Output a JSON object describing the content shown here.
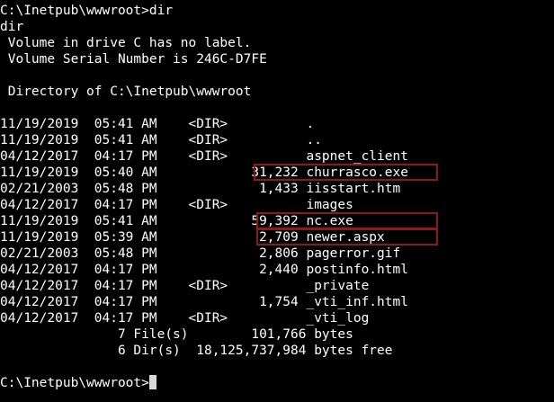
{
  "terminal": {
    "lines": [
      "C:\\Inetpub\\wwwroot>dir",
      "dir",
      " Volume in drive C has no label.",
      " Volume Serial Number is 246C-D7FE",
      "",
      " Directory of C:\\Inetpub\\wwwroot",
      "",
      "11/19/2019  05:41 AM    <DIR>          .",
      "11/19/2019  05:41 AM    <DIR>          ..",
      "04/12/2017  04:17 PM    <DIR>          aspnet_client",
      "11/19/2019  05:40 AM            31,232 churrasco.exe",
      "02/21/2003  05:48 PM             1,433 iisstart.htm",
      "04/12/2017  04:17 PM    <DIR>          images",
      "11/19/2019  05:41 AM            59,392 nc.exe",
      "11/19/2019  05:39 AM             2,709 newer.aspx",
      "02/21/2003  05:48 PM             2,806 pagerror.gif",
      "04/12/2017  04:17 PM             2,440 postinfo.html",
      "04/12/2017  04:17 PM    <DIR>          _private",
      "04/12/2017  04:17 PM             1,754 _vti_inf.html",
      "04/12/2017  04:17 PM    <DIR>          _vti_log",
      "               7 File(s)        101,766 bytes",
      "               6 Dir(s)  18,125,737,984 bytes free",
      "",
      "C:\\Inetpub\\wwwroot>"
    ],
    "highlighted_entries": [
      "churrasco.exe",
      "nc.exe",
      "newer.aspx"
    ],
    "highlight_color": "#8b1a1a",
    "background_color": "#000000",
    "text_color": "#ffffff"
  }
}
